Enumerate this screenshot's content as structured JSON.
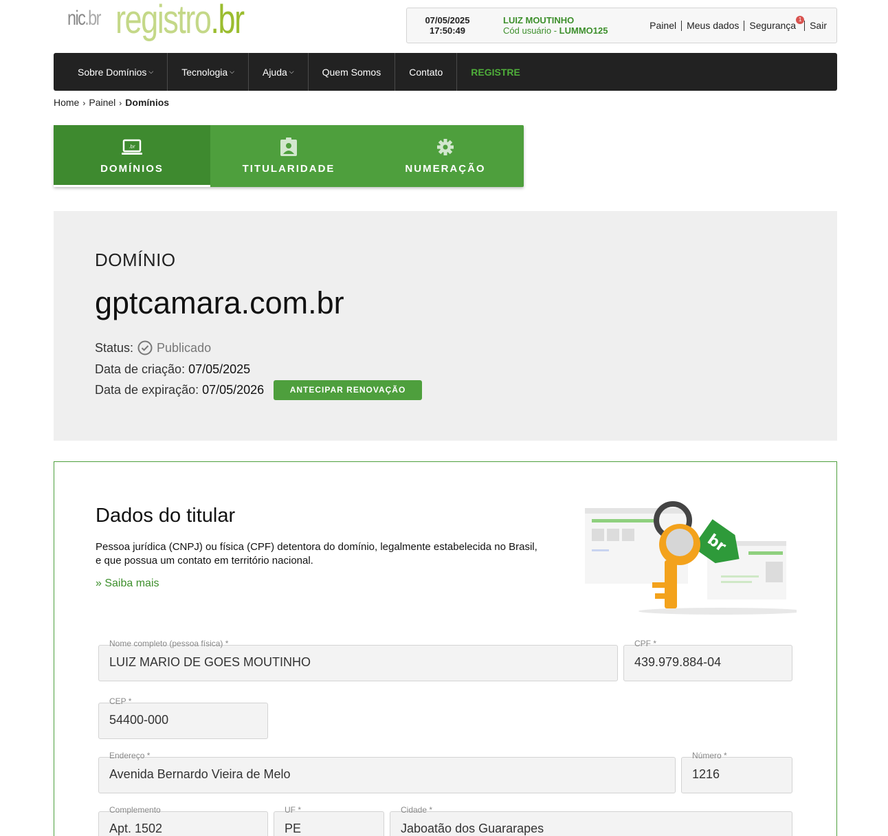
{
  "header": {
    "logo_nic": "nic",
    "logo_nic_br": ".br",
    "logo_registro": "registro",
    "logo_registro_br": ".br",
    "date": "07/05/2025",
    "time": "17:50:49",
    "user_name": "LUIZ MOUTINHO",
    "user_code_label": "Cód usuário - ",
    "user_code": "LUMMO125",
    "links": {
      "painel": "Painel",
      "meus_dados": "Meus dados",
      "seguranca": "Segurança",
      "seguranca_badge": "1",
      "sair": "Sair"
    }
  },
  "nav": {
    "items": [
      {
        "label": "Sobre Domínios"
      },
      {
        "label": "Tecnologia"
      },
      {
        "label": "Ajuda"
      },
      {
        "label": "Quem Somos"
      },
      {
        "label": "Contato"
      },
      {
        "label": "REGISTRE"
      }
    ]
  },
  "breadcrumb": {
    "home": "Home",
    "painel": "Painel",
    "current": "Domínios"
  },
  "tabs": [
    {
      "label": "DOMÍNIOS",
      "icon": "laptop-br-icon"
    },
    {
      "label": "TITULARIDADE",
      "icon": "badge-person-icon"
    },
    {
      "label": "NUMERAÇÃO",
      "icon": "gear-icon"
    }
  ],
  "domain": {
    "section_label": "DOMÍNIO",
    "name": "gptcamara.com.br",
    "status_label": "Status:",
    "status_value": "Publicado",
    "created_label": "Data de criação:",
    "created_value": "07/05/2025",
    "expire_label": "Data de expiração:",
    "expire_value": "07/05/2026",
    "renew_button": "ANTECIPAR RENOVAÇÃO"
  },
  "holder": {
    "title": "Dados do titular",
    "description": "Pessoa jurídica (CNPJ) ou física (CPF) detentora do domínio, legalmente estabelecida no Brasil, e que possua um contato em território nacional.",
    "more_link": "» Saiba mais",
    "illustration_tag": "br",
    "fields": {
      "nome": {
        "label": "Nome completo (pessoa física) *",
        "value": "LUIZ MARIO DE GOES MOUTINHO"
      },
      "cpf": {
        "label": "CPF *",
        "value": "439.979.884-04"
      },
      "cep": {
        "label": "CEP *",
        "value": "54400-000"
      },
      "endereco": {
        "label": "Endereço *",
        "value": "Avenida Bernardo Vieira de Melo"
      },
      "numero": {
        "label": "Número *",
        "value": "1216"
      },
      "complemento": {
        "label": "Complemento",
        "value": "Apt. 1502"
      },
      "uf": {
        "label": "UF *",
        "value": "PE"
      },
      "cidade": {
        "label": "Cidade *",
        "value": "Jaboatão dos Guararapes"
      }
    }
  },
  "colors": {
    "brand_green": "#4e9f3d",
    "nav_bg": "#222222",
    "panel_bg": "#efefef",
    "badge_red": "#d9534f"
  }
}
